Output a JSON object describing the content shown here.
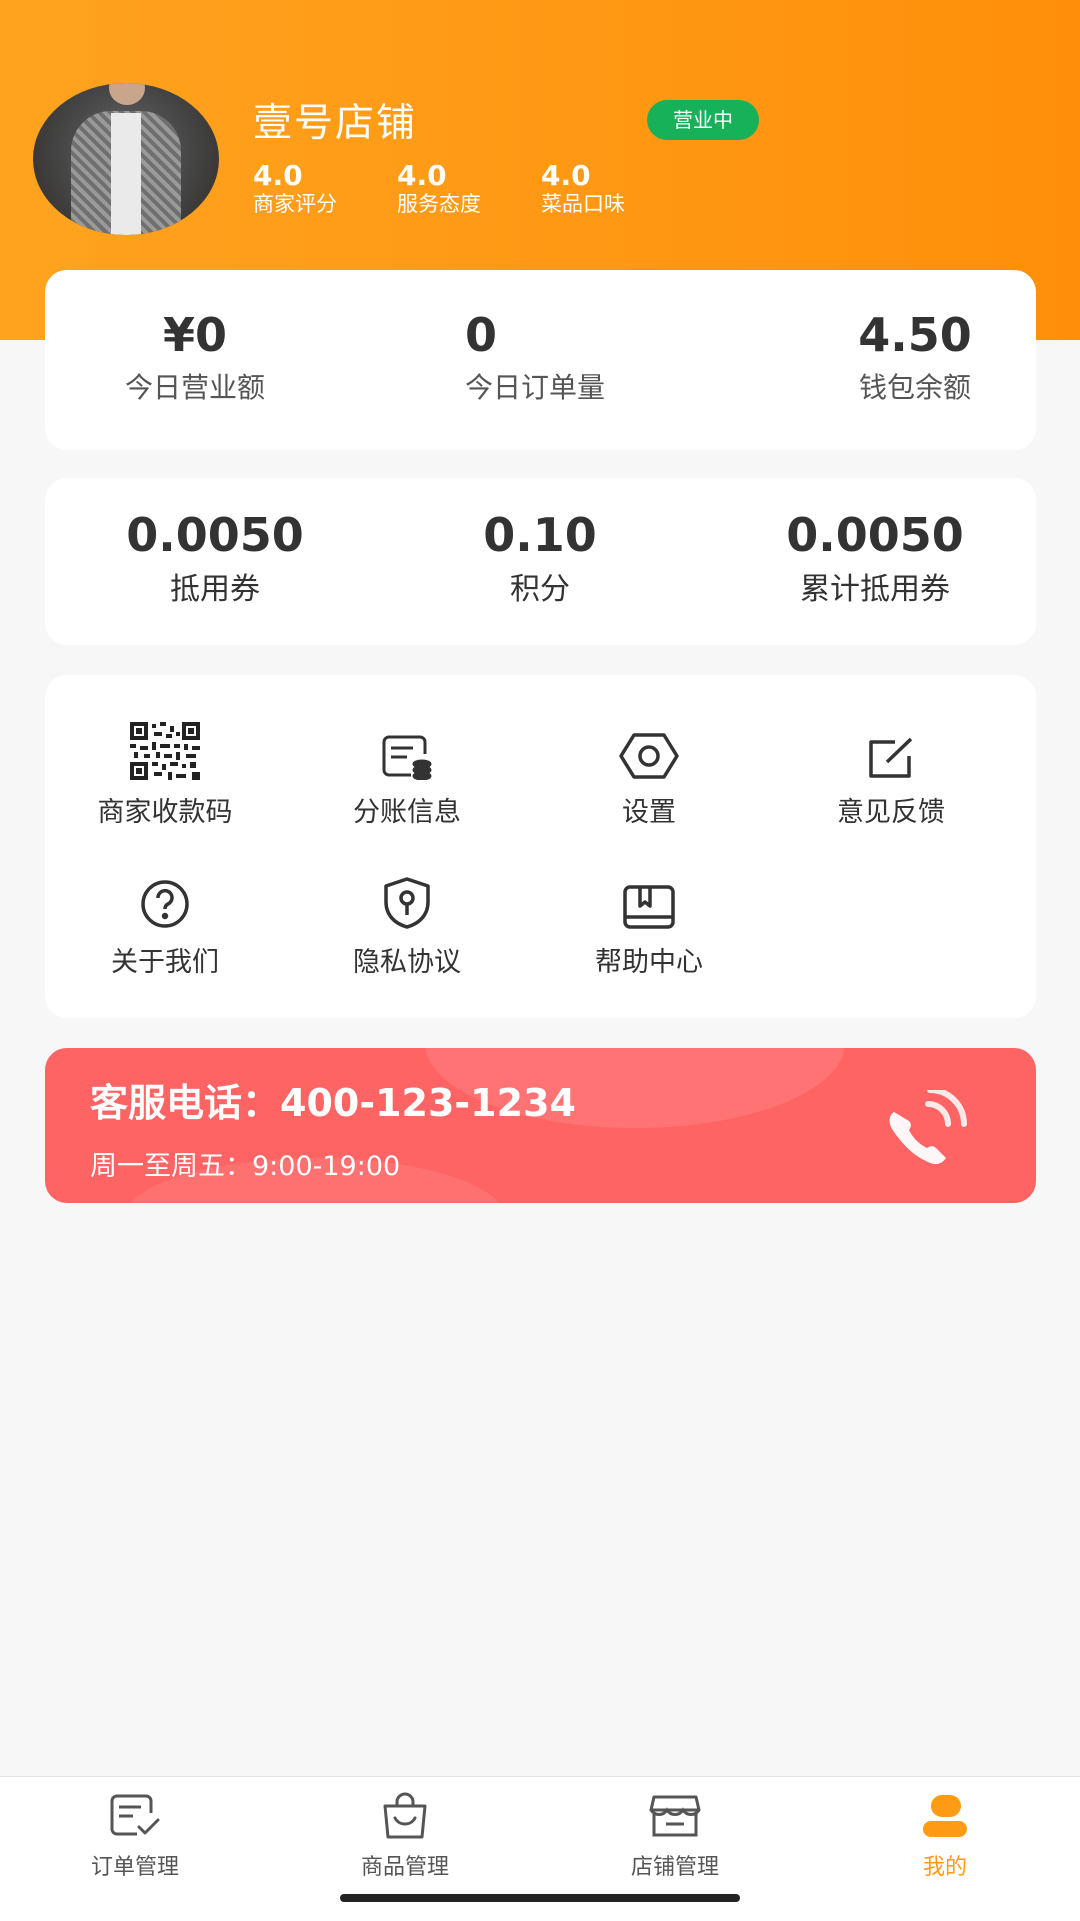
{
  "header": {
    "shop_name": "壹号店铺",
    "status": "营业中",
    "ratings": [
      {
        "value": "4.0",
        "label": "商家评分"
      },
      {
        "value": "4.0",
        "label": "服务态度"
      },
      {
        "value": "4.0",
        "label": "菜品口味"
      }
    ]
  },
  "summary": {
    "items": [
      {
        "value": "¥0",
        "label": "今日营业额"
      },
      {
        "value": "0",
        "label": "今日订单量"
      },
      {
        "value": "4.50",
        "label": "钱包余额"
      }
    ]
  },
  "assets": {
    "items": [
      {
        "value": "0.0050",
        "label": "抵用券"
      },
      {
        "value": "0.10",
        "label": "积分"
      },
      {
        "value": "0.0050",
        "label": "累计抵用券"
      }
    ]
  },
  "menu": {
    "items": [
      {
        "label": "商家收款码",
        "icon": "qr-code-icon"
      },
      {
        "label": "分账信息",
        "icon": "split-bill-icon"
      },
      {
        "label": "设置",
        "icon": "settings-hex-icon"
      },
      {
        "label": "意见反馈",
        "icon": "feedback-edit-icon"
      },
      {
        "label": "关于我们",
        "icon": "question-circle-icon"
      },
      {
        "label": "隐私协议",
        "icon": "shield-key-icon"
      },
      {
        "label": "帮助中心",
        "icon": "book-icon"
      }
    ]
  },
  "service": {
    "phone": "客服电话：400-123-1234",
    "hours": "周一至周五：9:00-19:00",
    "icon": "phone-call-icon"
  },
  "tabbar": {
    "items": [
      {
        "label": "订单管理",
        "icon": "order-icon"
      },
      {
        "label": "商品管理",
        "icon": "shopping-bag-icon"
      },
      {
        "label": "店铺管理",
        "icon": "store-icon"
      },
      {
        "label": "我的",
        "icon": "user-icon",
        "active": true
      }
    ]
  },
  "colors": {
    "brand_orange": "#ff9a14",
    "status_green": "#17b15a",
    "service_red": "#ff6465"
  }
}
